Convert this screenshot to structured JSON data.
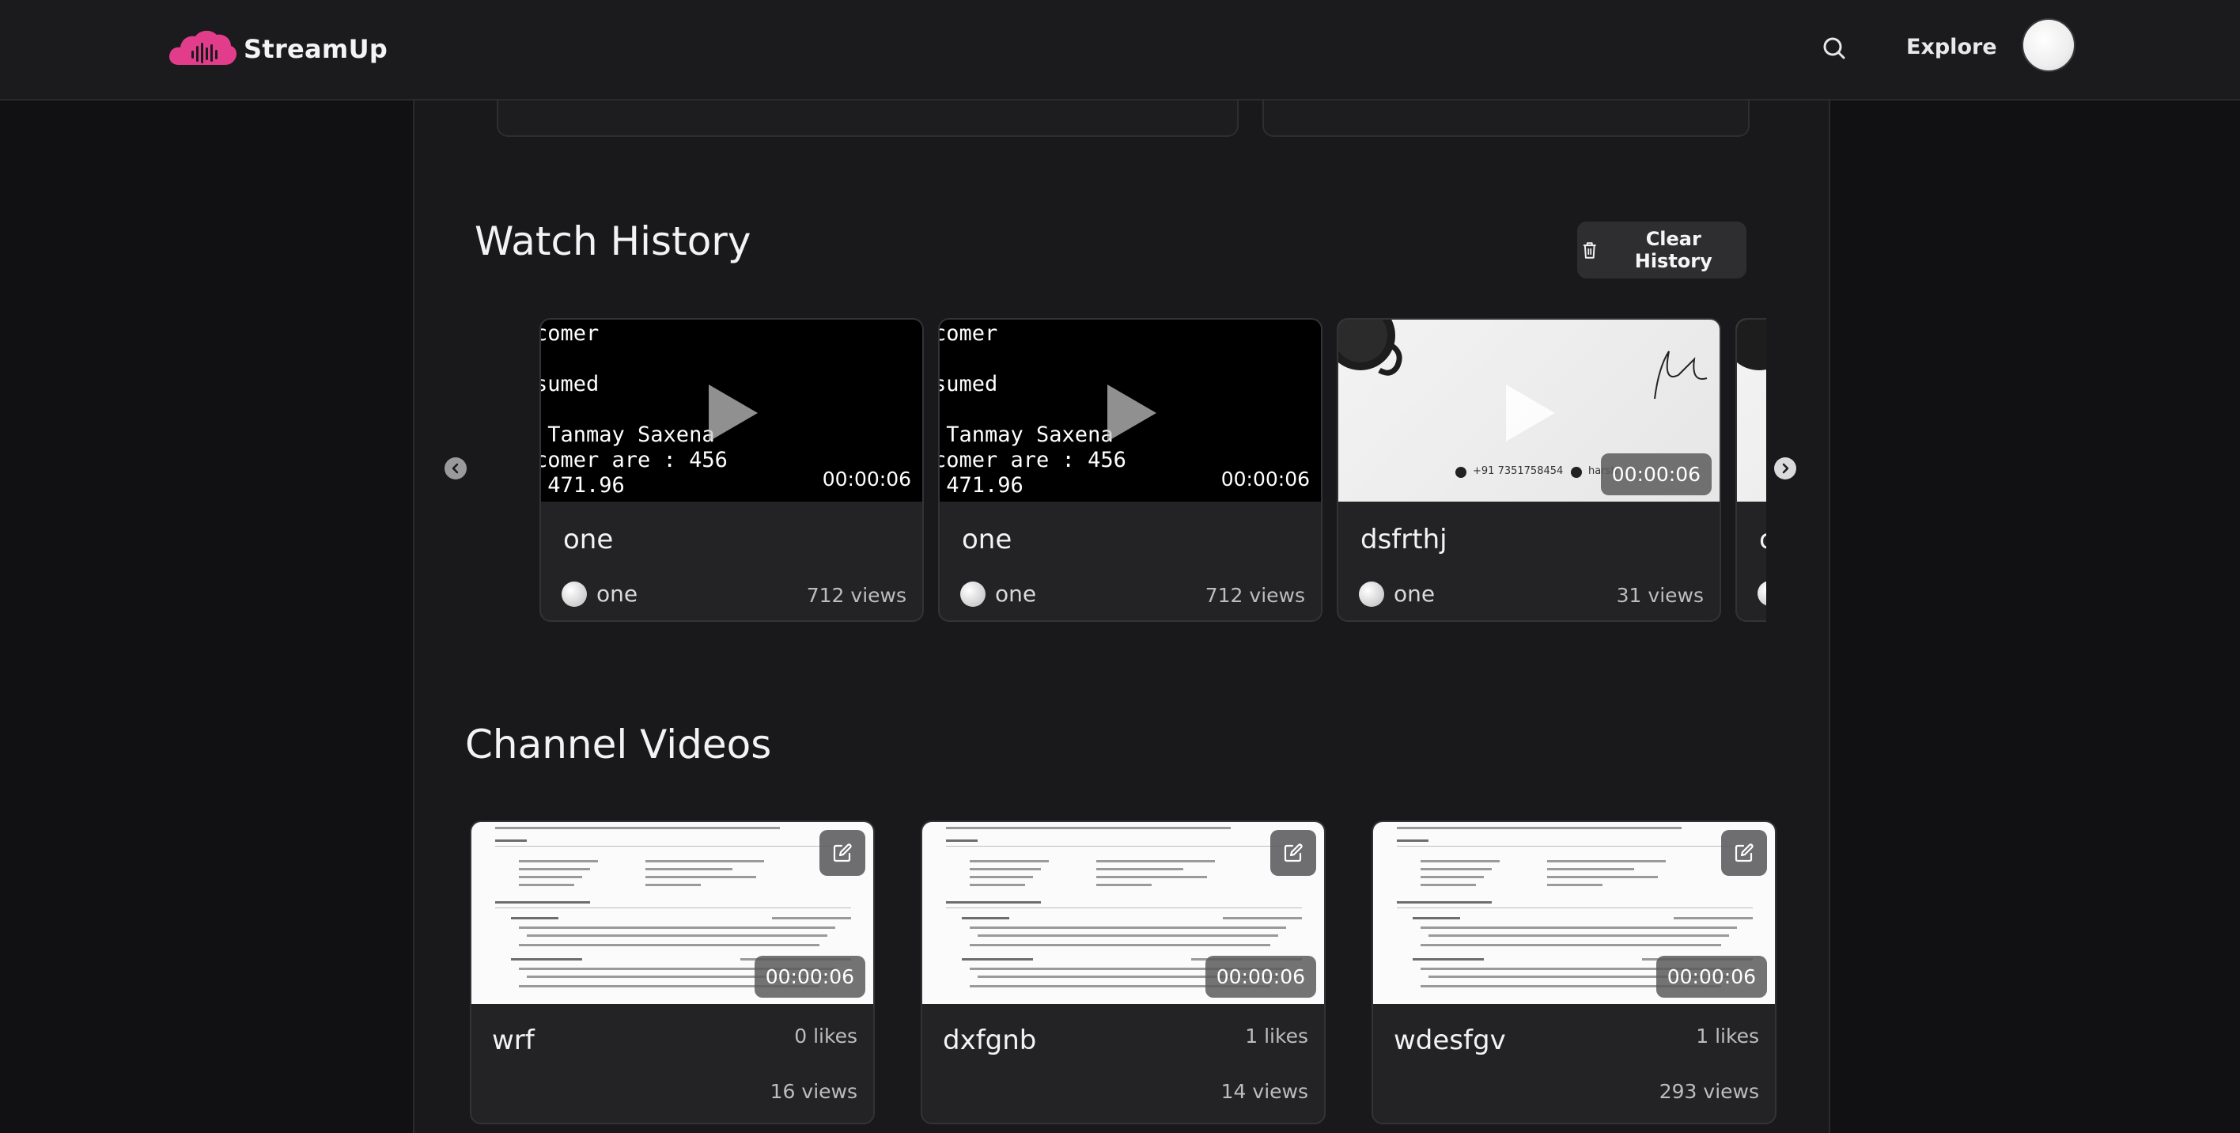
{
  "app": {
    "name": "StreamUp"
  },
  "nav": {
    "explore_label": "Explore"
  },
  "icons": {
    "logo": "cloud-soundwave-icon",
    "search": "search-icon",
    "trash": "trash-icon",
    "prev": "chevron-left-icon",
    "next": "chevron-right-icon",
    "play": "play-icon",
    "edit": "edit-icon"
  },
  "colors": {
    "brand": "#e23d8b",
    "background": "#111113",
    "panel": "#19191b",
    "card": "#232326"
  },
  "watch_history": {
    "title": "Watch History",
    "clear_label": "Clear History",
    "items": [
      {
        "title": "one",
        "channel": "one",
        "views": "712 views",
        "duration": "00:00:06",
        "thumb_lines": [
          "comer",
          "",
          "sumed",
          "",
          " Tanmay Saxena",
          "comer are : 456",
          " 471.96"
        ]
      },
      {
        "title": "one",
        "channel": "one",
        "views": "712 views",
        "duration": "00:00:06",
        "thumb_lines": [
          "comer",
          "",
          "sumed",
          "",
          " Tanmay Saxena",
          "comer are : 456",
          " 471.96"
        ]
      },
      {
        "title": "dsfrthj",
        "channel": "one",
        "views": "31 views",
        "duration": "00:00:06",
        "thumb_phone": "+91 7351758454",
        "thumb_email": "harsh"
      },
      {
        "title": "c"
      }
    ]
  },
  "channel_videos": {
    "title": "Channel Videos",
    "items": [
      {
        "title": "wrf",
        "likes": "0 likes",
        "views": "16 views",
        "duration": "00:00:06"
      },
      {
        "title": "dxfgnb",
        "likes": "1 likes",
        "views": "14 views",
        "duration": "00:00:06"
      },
      {
        "title": "wdesfgv",
        "likes": "1 likes",
        "views": "293 views",
        "duration": "00:00:06"
      }
    ]
  }
}
